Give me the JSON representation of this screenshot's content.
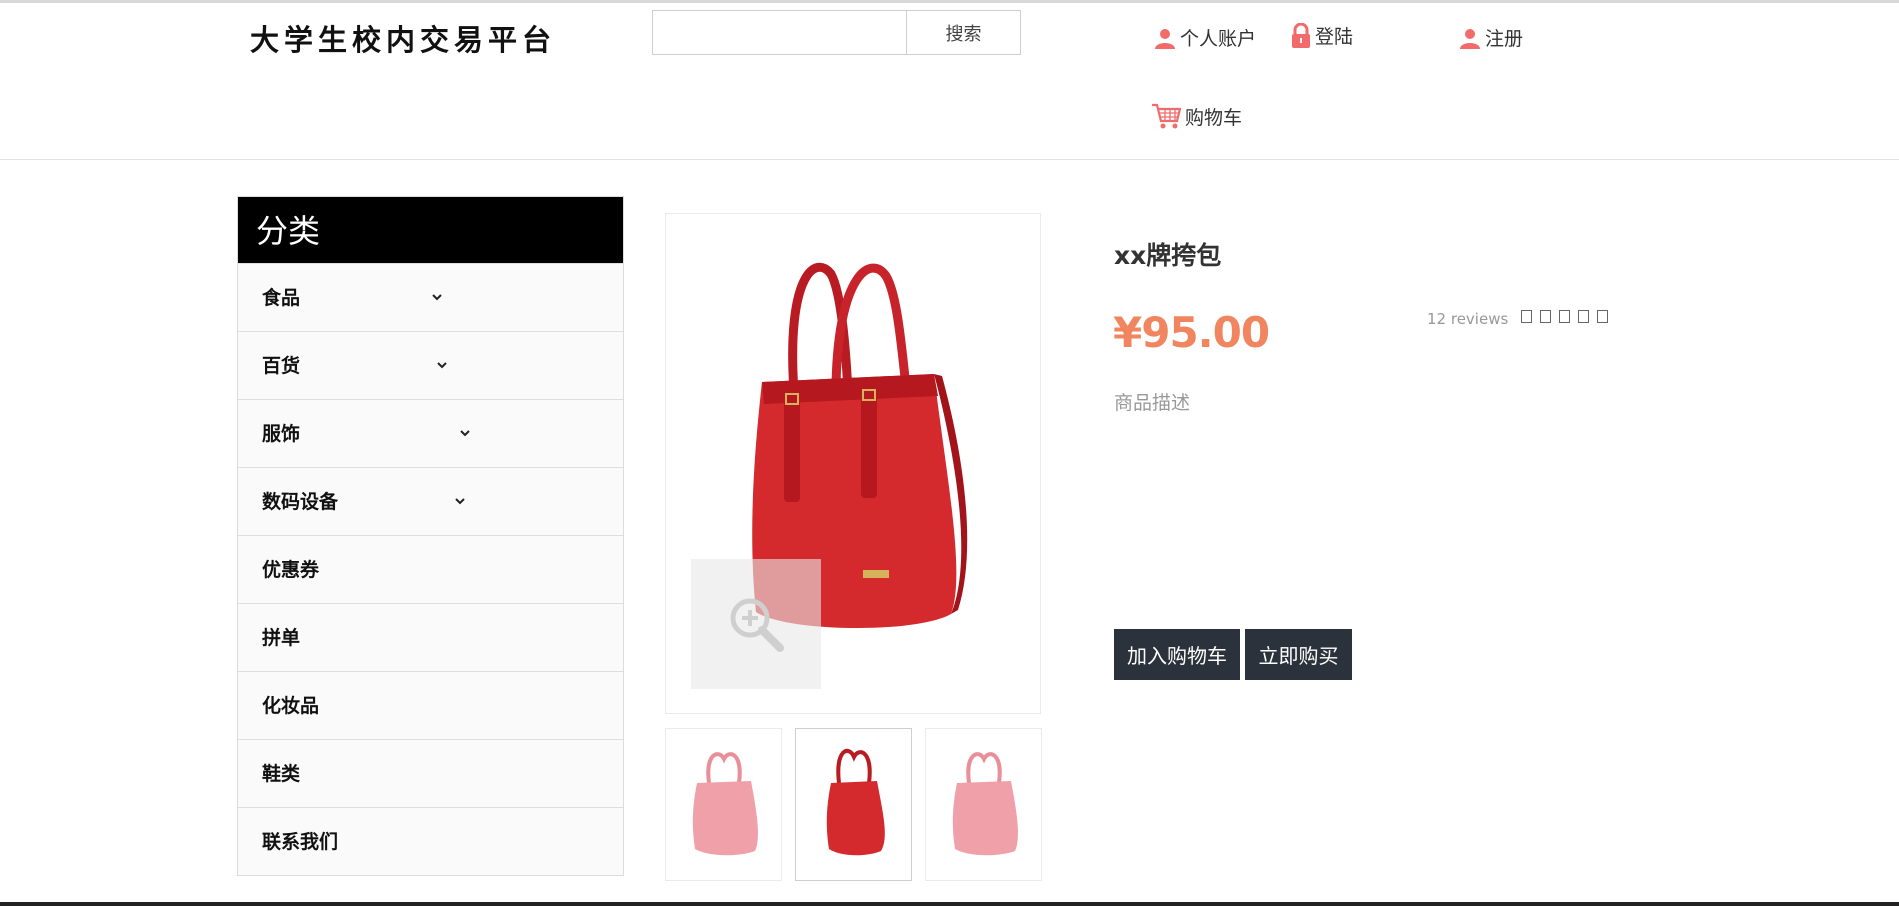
{
  "header": {
    "logo_text": "大学生校内交易平台",
    "search": {
      "placeholder": "",
      "value": "",
      "button_label": "搜索"
    },
    "links": {
      "account": "个人账户",
      "login": "登陆",
      "register": "注册",
      "cart": "购物车"
    }
  },
  "sidebar": {
    "title": "分类",
    "items": [
      {
        "label": "食品",
        "has_submenu": true
      },
      {
        "label": "百货",
        "has_submenu": true
      },
      {
        "label": "服饰",
        "has_submenu": true
      },
      {
        "label": "数码设备",
        "has_submenu": true
      },
      {
        "label": "优惠券",
        "has_submenu": false
      },
      {
        "label": "拼单",
        "has_submenu": false
      },
      {
        "label": "化妆品",
        "has_submenu": false
      },
      {
        "label": "鞋类",
        "has_submenu": false
      },
      {
        "label": "联系我们",
        "has_submenu": false
      }
    ]
  },
  "product": {
    "title": "xx牌挎包",
    "price": "¥95.00",
    "reviews": "12 reviews",
    "star_count": 5,
    "description": "商品描述",
    "add_to_cart_label": "加入购物车",
    "buy_now_label": "立即购买",
    "thumbnails_count": 3,
    "active_thumbnail": 2
  },
  "colors": {
    "price": "#f0855f",
    "icon_accent": "#f26a6a",
    "button_bg": "#2b323b",
    "sidebar_header_bg": "#000000",
    "bag_red": "#d42a2e",
    "bag_pink": "#f0a0a8"
  }
}
